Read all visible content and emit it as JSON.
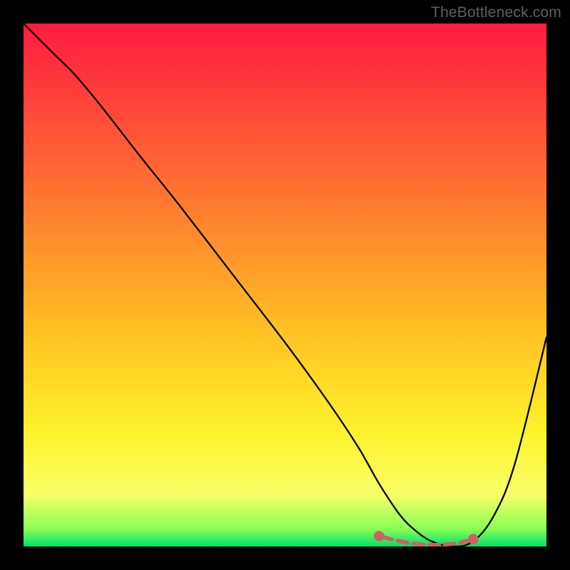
{
  "watermark": "TheBottleneck.com",
  "chart_data": {
    "type": "line",
    "title": "",
    "xlabel": "",
    "ylabel": "",
    "xlim": [
      0,
      100
    ],
    "ylim": [
      0,
      100
    ],
    "grid": false,
    "legend": false,
    "background_gradient": {
      "stops": [
        {
          "offset": 0.0,
          "color": "#ff1a3f"
        },
        {
          "offset": 0.2,
          "color": "#ff5138"
        },
        {
          "offset": 0.4,
          "color": "#ff8a2c"
        },
        {
          "offset": 0.6,
          "color": "#ffc423"
        },
        {
          "offset": 0.78,
          "color": "#fff22c"
        },
        {
          "offset": 0.9,
          "color": "#f7ff66"
        },
        {
          "offset": 0.965,
          "color": "#8eff55"
        },
        {
          "offset": 1.0,
          "color": "#00e06a"
        }
      ]
    },
    "series": [
      {
        "name": "bottleneck-curve",
        "color": "#000000",
        "x": [
          0,
          3,
          6,
          10,
          15,
          22,
          30,
          40,
          50,
          58,
          64,
          68,
          72,
          75,
          78,
          82,
          86,
          90,
          94,
          100
        ],
        "y": [
          100,
          97,
          94,
          90,
          84,
          75,
          65,
          52,
          39,
          28,
          19,
          12,
          6,
          3,
          1,
          0,
          1,
          6,
          16,
          40
        ]
      }
    ],
    "highlight": {
      "name": "optimal-zone",
      "color": "#cf6060",
      "x": [
        68,
        71,
        74,
        77,
        80,
        83,
        86
      ],
      "y": [
        2,
        1.2,
        0.6,
        0.3,
        0.3,
        0.6,
        1.4
      ]
    }
  }
}
